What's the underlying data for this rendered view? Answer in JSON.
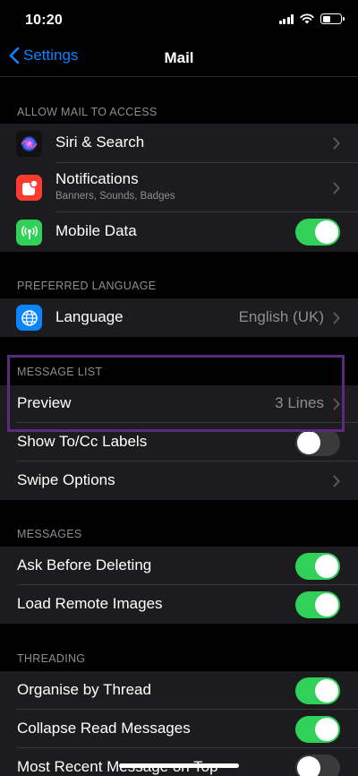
{
  "status_bar": {
    "time": "10:20"
  },
  "nav": {
    "back_label": "Settings",
    "title": "Mail"
  },
  "sections": {
    "allow_access": {
      "header": "ALLOW MAIL TO ACCESS",
      "siri": {
        "label": "Siri & Search",
        "icon": "siri-icon"
      },
      "notifications": {
        "label": "Notifications",
        "sublabel": "Banners, Sounds, Badges",
        "icon": "notifications-icon",
        "icon_color": "#ff3b30"
      },
      "mobile_data": {
        "label": "Mobile Data",
        "icon": "antenna-icon",
        "icon_color": "#30d158",
        "enabled": true
      }
    },
    "language": {
      "header": "PREFERRED LANGUAGE",
      "language": {
        "label": "Language",
        "value": "English (UK)",
        "icon": "globe-icon",
        "icon_color": "#0a84ff"
      }
    },
    "message_list": {
      "header": "MESSAGE LIST",
      "preview": {
        "label": "Preview",
        "value": "3 Lines"
      },
      "show_tocc": {
        "label": "Show To/Cc Labels",
        "enabled": false
      },
      "swipe": {
        "label": "Swipe Options"
      }
    },
    "messages": {
      "header": "MESSAGES",
      "ask_delete": {
        "label": "Ask Before Deleting",
        "enabled": true
      },
      "remote_images": {
        "label": "Load Remote Images",
        "enabled": true
      }
    },
    "threading": {
      "header": "THREADING",
      "organise": {
        "label": "Organise by Thread",
        "enabled": true
      },
      "collapse": {
        "label": "Collapse Read Messages",
        "enabled": true
      },
      "recent_top": {
        "label": "Most Recent Message on Top",
        "enabled": false
      }
    }
  },
  "colors": {
    "accent": "#0a84ff",
    "toggle_on": "#30d158",
    "highlight": "#5b2a7f"
  }
}
